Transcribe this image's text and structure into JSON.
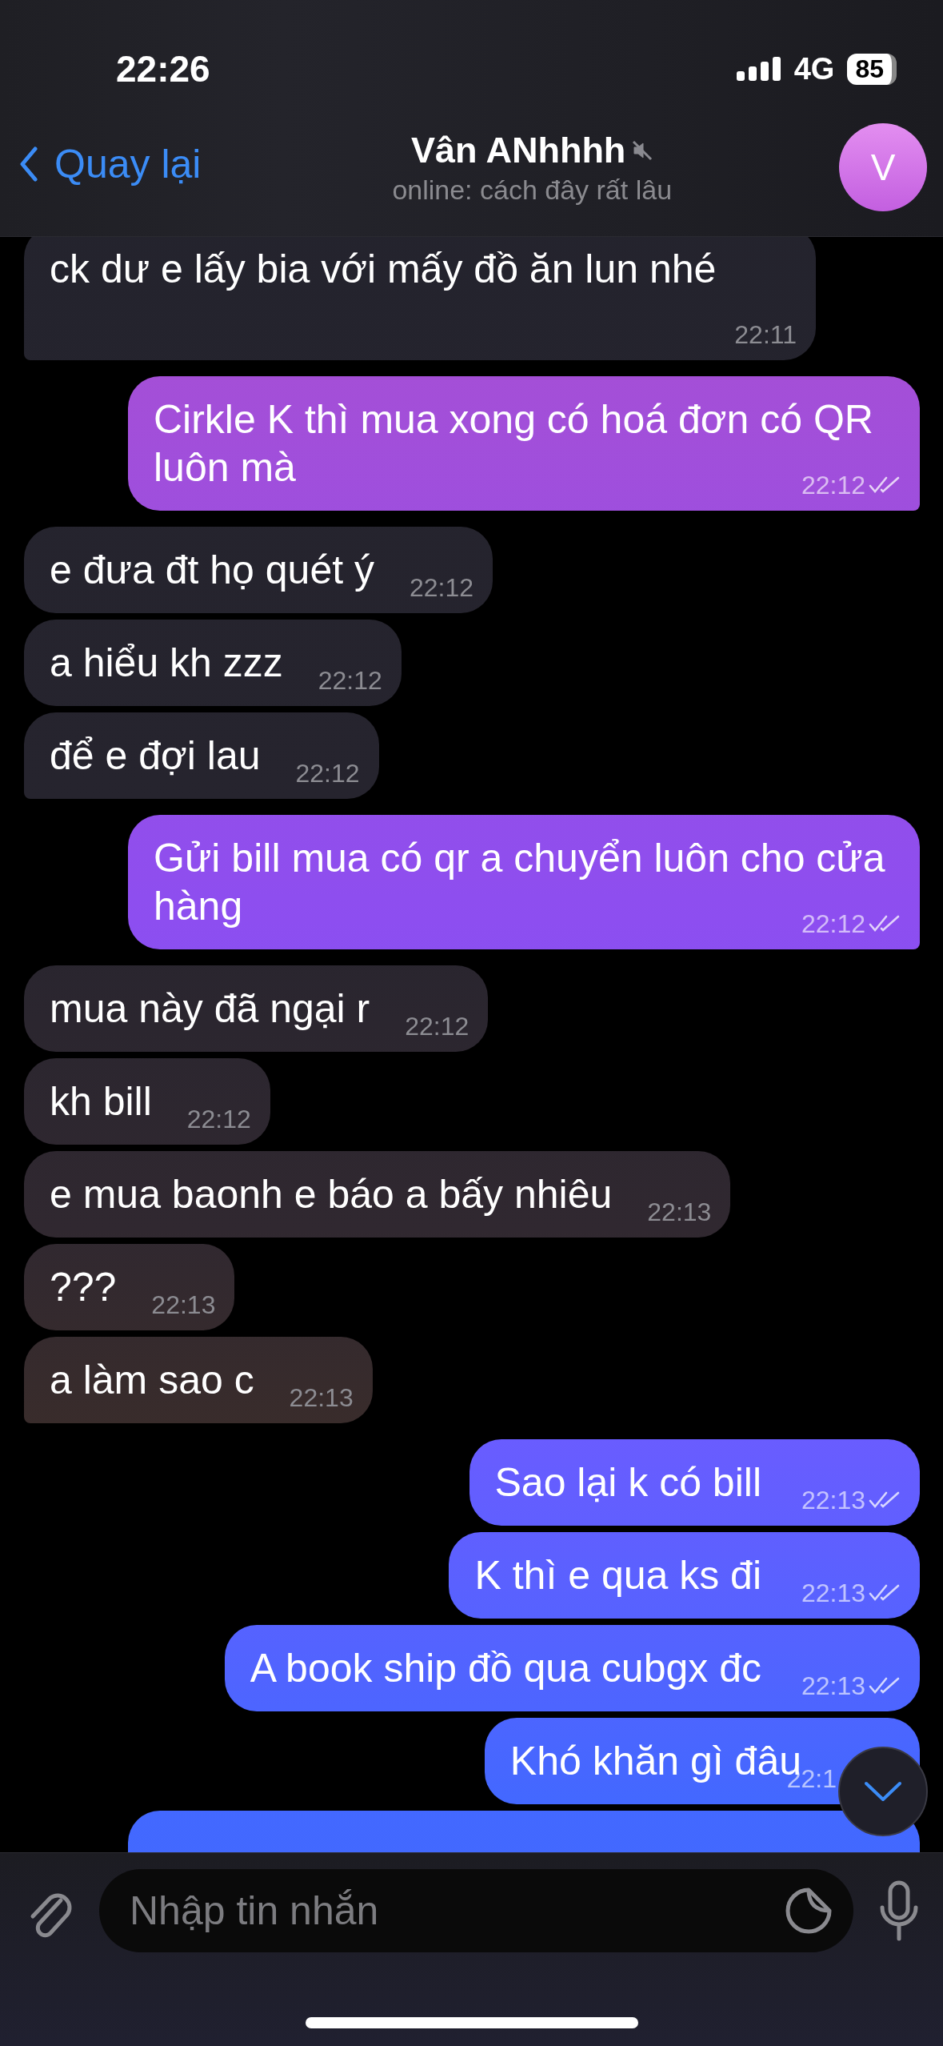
{
  "status_bar": {
    "time": "22:26",
    "network": "4G",
    "battery": "85"
  },
  "header": {
    "back_label": "Quay lại",
    "title": "Vân ANhhhh",
    "muted": true,
    "subtitle": "online: cách đây rất lâu",
    "avatar_letter": "V"
  },
  "messages": [
    {
      "kind": "incoming",
      "text": "ck dư e lấy bia với mấy đồ ăn lun nhé",
      "time": "22:11",
      "group_end": true
    },
    {
      "kind": "outgoing",
      "text": "Cirkle K thì mua xong có hoá đơn có QR luôn mà",
      "time": "22:12",
      "read": true,
      "group_end": true
    },
    {
      "kind": "incoming",
      "text": "e đưa đt họ quét ý",
      "time": "22:12",
      "group_end": false
    },
    {
      "kind": "incoming",
      "text": "a hiểu kh zzz",
      "time": "22:12",
      "group_end": false
    },
    {
      "kind": "incoming",
      "text": "để e đợi lau",
      "time": "22:12",
      "group_end": true
    },
    {
      "kind": "outgoing",
      "text": "Gửi bill mua có qr a chuyển luôn cho cửa hàng",
      "time": "22:12",
      "read": true,
      "group_end": true
    },
    {
      "kind": "incoming",
      "text": "mua này đã ngại r",
      "time": "22:12",
      "group_end": false
    },
    {
      "kind": "incoming",
      "text": "kh bill",
      "time": "22:12",
      "group_end": false
    },
    {
      "kind": "incoming",
      "text": "e mua baonh e báo a bấy nhiêu",
      "time": "22:13",
      "group_end": false
    },
    {
      "kind": "incoming",
      "text": "???",
      "time": "22:13",
      "group_end": false
    },
    {
      "kind": "incoming",
      "text": "a làm sao c",
      "time": "22:13",
      "group_end": true
    },
    {
      "kind": "outgoing",
      "text": "Sao lại k có bill",
      "time": "22:13",
      "read": true,
      "group_end": false
    },
    {
      "kind": "outgoing",
      "text": "K thì e qua ks đi",
      "time": "22:13",
      "read": true,
      "group_end": false
    },
    {
      "kind": "outgoing",
      "text": "A book ship đồ qua cubgx đc",
      "time": "22:13",
      "read": true,
      "group_end": false
    },
    {
      "kind": "outgoing",
      "text": "Khó khăn gì đâu",
      "time": "22:1",
      "group_end": false
    },
    {
      "kind": "outgoing",
      "group_end": false
    }
  ],
  "composer": {
    "placeholder": "Nhập tin nhắn"
  }
}
